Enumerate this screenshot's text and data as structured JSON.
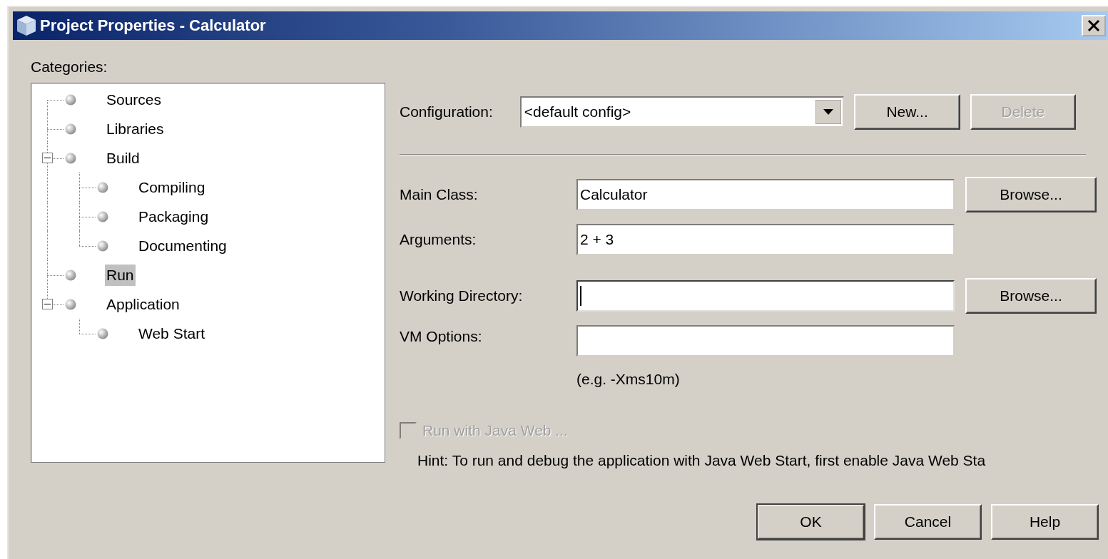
{
  "window": {
    "title": "Project Properties - Calculator"
  },
  "categories": {
    "label": "Categories:",
    "items": [
      {
        "label": "Sources",
        "selected": false
      },
      {
        "label": "Libraries",
        "selected": false
      },
      {
        "label": "Build",
        "selected": false,
        "expanded": true,
        "children": [
          {
            "label": "Compiling",
            "selected": false
          },
          {
            "label": "Packaging",
            "selected": false
          },
          {
            "label": "Documenting",
            "selected": false
          }
        ]
      },
      {
        "label": "Run",
        "selected": true
      },
      {
        "label": "Application",
        "selected": false,
        "expanded": true,
        "children": [
          {
            "label": "Web Start",
            "selected": false
          }
        ]
      }
    ]
  },
  "configuration": {
    "label": "Configuration:",
    "value": "<default config>",
    "buttons": [
      {
        "label": "New...",
        "disabled": false
      },
      {
        "label": "Delete",
        "disabled": true
      }
    ]
  },
  "fields": [
    {
      "label": "Main Class:",
      "value": "Calculator",
      "button": "Browse...",
      "focused": false
    },
    {
      "label": "Arguments:",
      "value": "2 + 3",
      "focused": false
    },
    {
      "label": "Working Directory:",
      "button": "Browse...",
      "focused": true
    },
    {
      "label": "VM Options:",
      "note": "(e.g. -Xms10m)",
      "focused": false
    }
  ],
  "web_start": {
    "label": "Run with Java Web ...",
    "checked": false,
    "disabled": true
  },
  "hint": "Hint: To run and debug the application with Java Web Start, first enable Java Web Sta",
  "dialog_buttons": [
    {
      "label": "OK",
      "default": true
    },
    {
      "label": "Cancel",
      "default": false
    },
    {
      "label": "Help",
      "default": false
    }
  ]
}
